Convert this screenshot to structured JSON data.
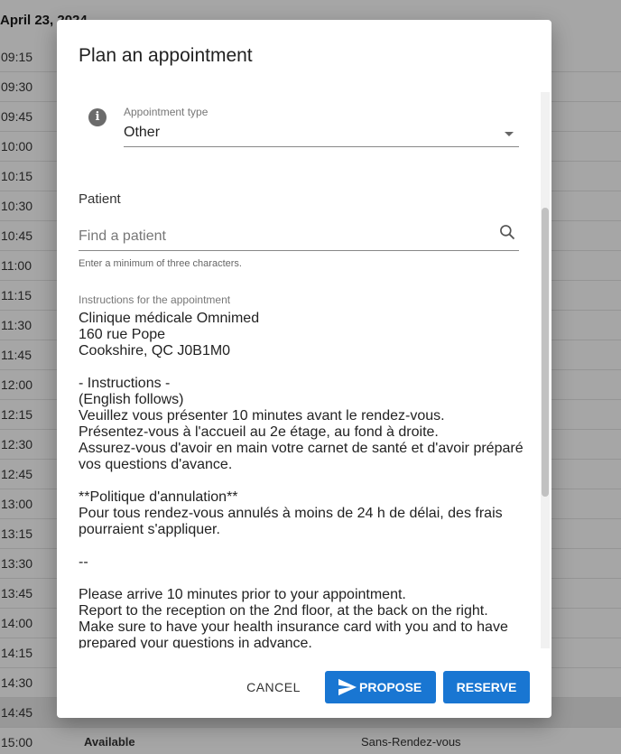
{
  "background": {
    "date": "April 23, 2024",
    "times": [
      "09:15",
      "09:30",
      "09:45",
      "10:00",
      "10:15",
      "10:30",
      "10:45",
      "11:00",
      "11:15",
      "11:30",
      "11:45",
      "12:00",
      "12:15",
      "12:30",
      "12:45",
      "13:00",
      "13:15",
      "13:30",
      "13:45",
      "14:00",
      "14:15",
      "14:30",
      "14:45",
      "15:00"
    ],
    "last_row": {
      "status": "Available",
      "location": "Sans-Rendez-vous"
    }
  },
  "dialog": {
    "title": "Plan an appointment",
    "appointment_type": {
      "label": "Appointment type",
      "value": "Other"
    },
    "patient": {
      "heading": "Patient",
      "placeholder": "Find a patient",
      "helper": "Enter a minimum of three characters."
    },
    "instructions": {
      "label": "Instructions for the appointment",
      "text": "Clinique médicale Omnimed\n160 rue Pope\nCookshire, QC J0B1M0\n\n- Instructions -\n(English follows)\nVeuillez vous présenter 10 minutes avant le rendez-vous.\nPrésentez-vous à l'accueil au 2e étage, au fond à droite.\nAssurez-vous d'avoir en main votre carnet de santé et d'avoir préparé vos questions d'avance.\n\n**Politique d'annulation**\nPour tous rendez-vous annulés à moins de 24 h de délai, des frais pourraient s'appliquer.\n\n--\n\nPlease arrive 10 minutes prior to your appointment.\nReport to the reception on the 2nd floor, at the back on the right.\nMake sure to have your health insurance card with you and to have prepared your questions in advance."
    },
    "buttons": {
      "cancel": "CANCEL",
      "propose": "PROPOSE",
      "reserve": "RESERVE"
    }
  }
}
